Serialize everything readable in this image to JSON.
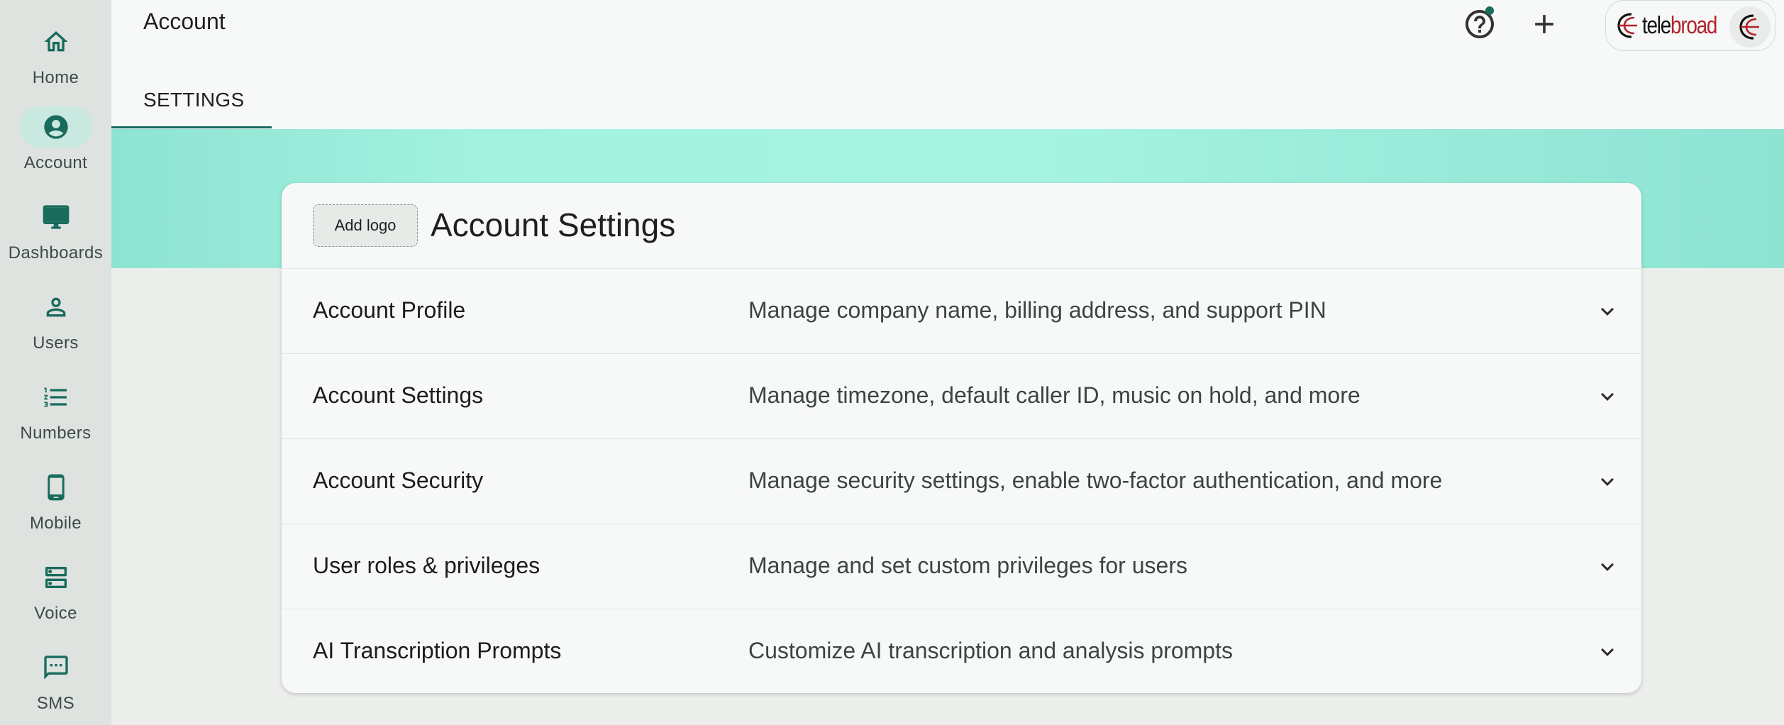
{
  "topbar": {
    "title": "Account",
    "tab_settings": "SETTINGS",
    "help_icon": "help-circle-icon",
    "add_icon": "plus-icon",
    "brand": {
      "part1": "tele",
      "part2": "broad",
      "color_dark": "#111111",
      "color_red": "#b4232a"
    }
  },
  "sidebar": {
    "items": [
      {
        "label": "Home",
        "icon": "home-icon",
        "active": false
      },
      {
        "label": "Account",
        "icon": "account-circle-icon",
        "active": true
      },
      {
        "label": "Dashboards",
        "icon": "monitor-icon",
        "active": false
      },
      {
        "label": "Users",
        "icon": "person-icon",
        "active": false
      },
      {
        "label": "Numbers",
        "icon": "list-numbered-icon",
        "active": false
      },
      {
        "label": "Mobile",
        "icon": "phone-icon",
        "active": false
      },
      {
        "label": "Voice",
        "icon": "server-icon",
        "active": false
      },
      {
        "label": "SMS",
        "icon": "chat-icon",
        "active": false
      }
    ]
  },
  "card": {
    "add_logo": "Add logo",
    "title": "Account Settings",
    "rows": [
      {
        "title": "Account Profile",
        "desc": "Manage company name, billing address, and support PIN"
      },
      {
        "title": "Account Settings",
        "desc": "Manage timezone, default caller ID, music on hold, and more"
      },
      {
        "title": "Account Security",
        "desc": "Manage security settings, enable two-factor authentication, and more"
      },
      {
        "title": "User roles & privileges",
        "desc": "Manage and set custom privileges for users"
      },
      {
        "title": "AI Transcription Prompts",
        "desc": "Customize AI transcription and analysis prompts"
      }
    ]
  },
  "colors": {
    "accent": "#196b5c",
    "banner": "#a3f2e0",
    "sidebar_bg": "#dee3e0",
    "active_pill": "#c9e9e0"
  }
}
